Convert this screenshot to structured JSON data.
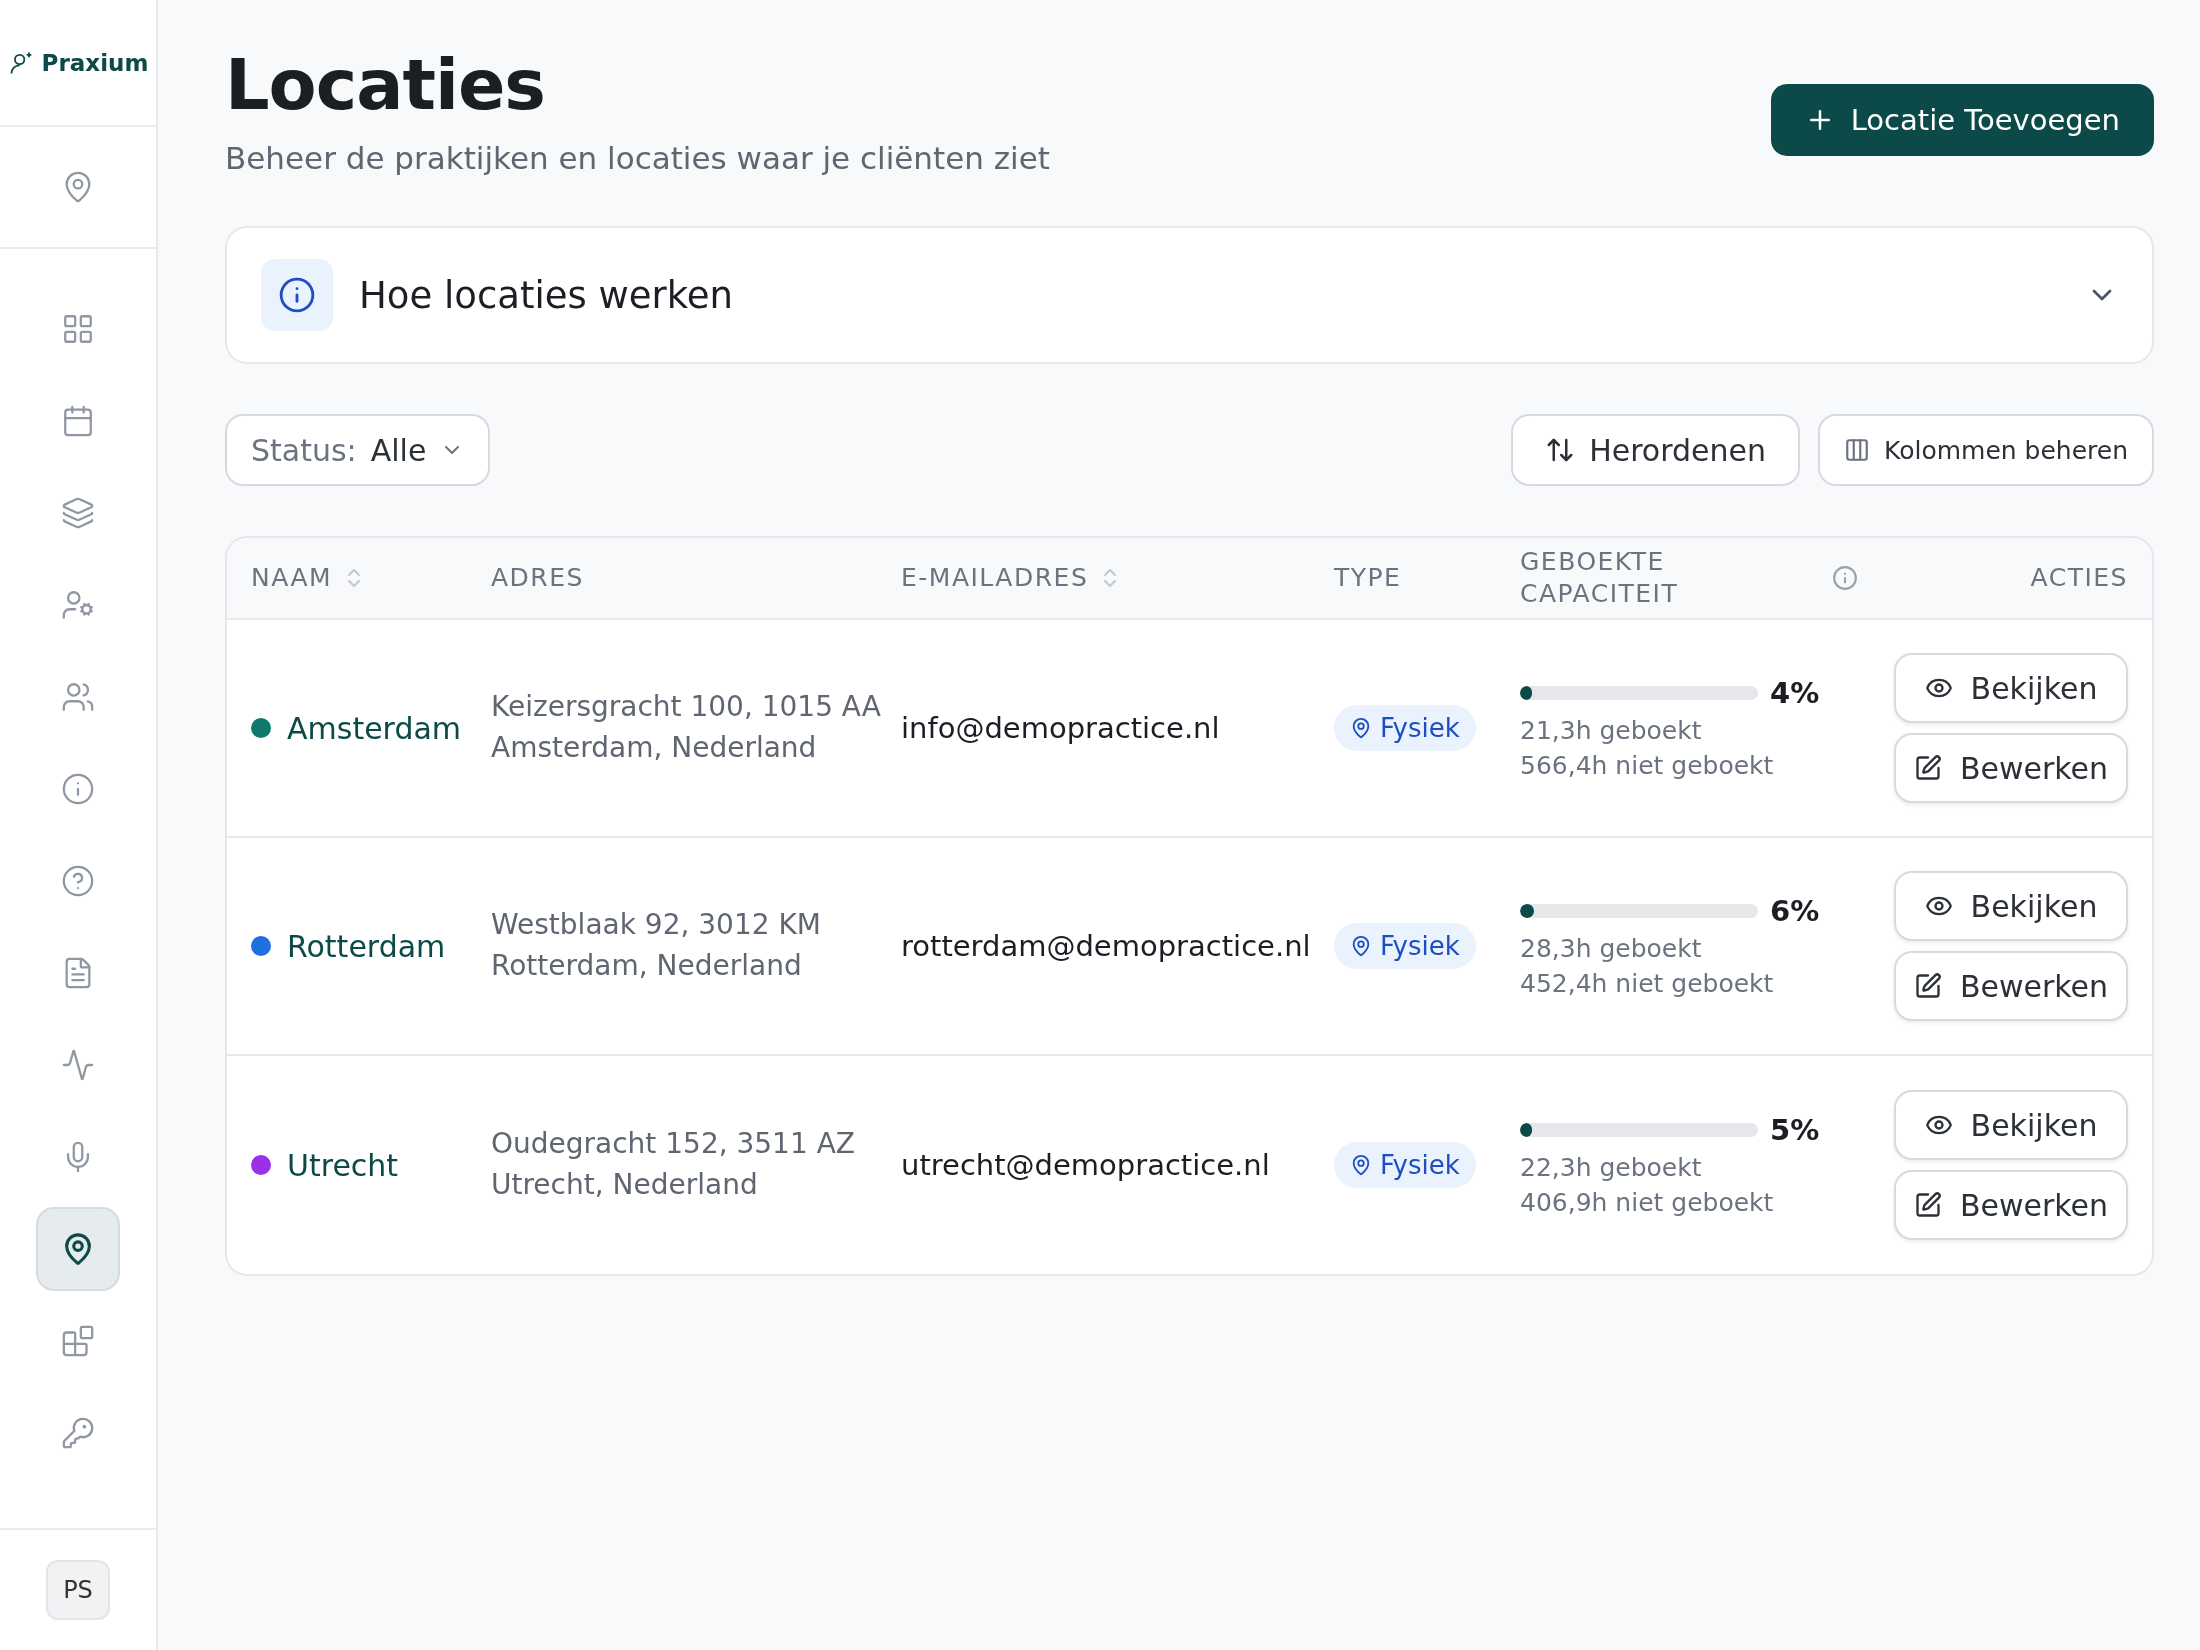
{
  "brand": {
    "name": "Praxium"
  },
  "sidebar": {
    "top_item": {
      "selected": false
    },
    "items": [
      {
        "selected": false
      },
      {
        "selected": false
      },
      {
        "selected": false
      },
      {
        "selected": false
      },
      {
        "selected": false
      },
      {
        "selected": false
      },
      {
        "selected": false
      },
      {
        "selected": false
      },
      {
        "selected": false
      },
      {
        "selected": false
      },
      {
        "selected": true
      },
      {
        "selected": false
      },
      {
        "selected": false
      }
    ],
    "avatar": "PS"
  },
  "header": {
    "title": "Locaties",
    "subtitle": "Beheer de praktijken en locaties waar je cliënten ziet",
    "add_button": "Locatie Toevoegen"
  },
  "info_panel": {
    "title": "Hoe locaties werken",
    "expanded": false
  },
  "filter": {
    "label": "Status:",
    "value": "Alle"
  },
  "toolbar": {
    "reorder": "Herordenen",
    "columns": "Kolommen beheren"
  },
  "table": {
    "columns": [
      {
        "label": "NAAM",
        "sortable": true
      },
      {
        "label": "ADRES",
        "sortable": false
      },
      {
        "label": "E-MAILADRES",
        "sortable": true
      },
      {
        "label": "TYPE",
        "sortable": false
      },
      {
        "label": "GEBOEKTE CAPACITEIT",
        "sortable": false
      },
      {
        "label": "ACTIES",
        "sortable": false
      }
    ],
    "rows": [
      {
        "color": "#0f7a6c",
        "name": "Amsterdam",
        "address_line1": "Keizersgracht 100, 1015 AA",
        "address_line2": "Amsterdam, Nederland",
        "email": "info@demopractice.nl",
        "type": "Fysiek",
        "level": 0.04,
        "percent": "4%",
        "booked": "21,3h geboekt",
        "unbooked": "566,4h niet geboekt",
        "view": "Bekijken",
        "edit": "Bewerken"
      },
      {
        "color": "#1f6fe0",
        "name": "Rotterdam",
        "address_line1": "Westblaak 92, 3012 KM",
        "address_line2": "Rotterdam, Nederland",
        "email": "rotterdam@demopractice.nl",
        "type": "Fysiek",
        "level": 0.06,
        "percent": "6%",
        "booked": "28,3h geboekt",
        "unbooked": "452,4h niet geboekt",
        "view": "Bekijken",
        "edit": "Bewerken"
      },
      {
        "color": "#9b30e8",
        "name": "Utrecht",
        "address_line1": "Oudegracht 152, 3511 AZ",
        "address_line2": "Utrecht, Nederland",
        "email": "utrecht@demopractice.nl",
        "type": "Fysiek",
        "level": 0.05,
        "percent": "5%",
        "booked": "22,3h geboekt",
        "unbooked": "406,9h niet geboekt",
        "view": "Bekijken",
        "edit": "Bewerken"
      }
    ]
  }
}
